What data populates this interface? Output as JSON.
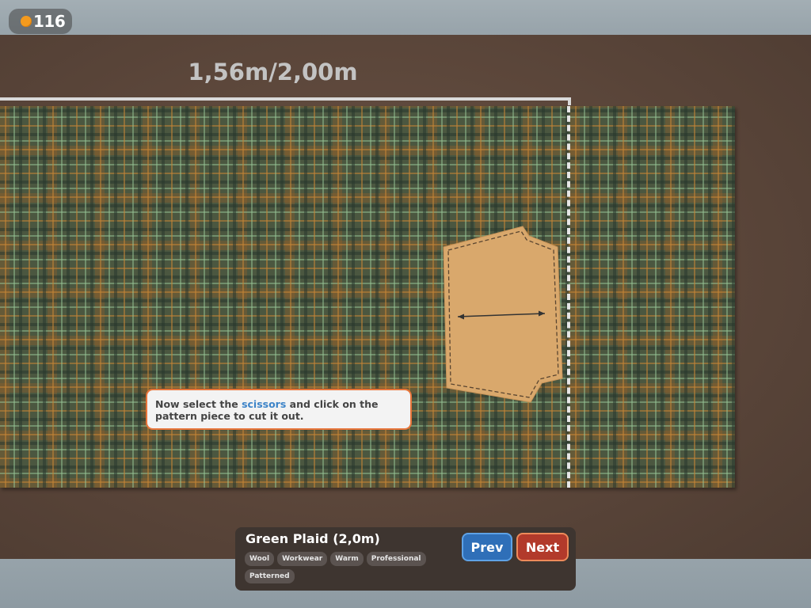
{
  "hud": {
    "coins": "116",
    "coin_icon": "coin-icon"
  },
  "measurement": {
    "label": "1,56m/2,00m"
  },
  "fabric": {
    "pattern": "green-plaid",
    "colors": {
      "base": "#4b5740",
      "orange_stripe": "#c48436",
      "light_stripe": "#96c496"
    }
  },
  "pattern_piece": {
    "color": "#d9a86c",
    "grain_arrow_icon": "double-arrow-icon"
  },
  "tooltip": {
    "text_before": "Now select the ",
    "highlight": "scissors",
    "text_after": " and click on the pattern piece to cut it out."
  },
  "info_panel": {
    "title": "Green Plaid (2,0m)",
    "tags": [
      "Wool",
      "Workwear",
      "Warm",
      "Professional",
      "Patterned"
    ],
    "prev_label": "Prev",
    "next_label": "Next"
  },
  "colors": {
    "accent_orange": "#e8753a",
    "highlight_blue": "#3d84c8",
    "prev_blue": "#2f6fb8",
    "next_red": "#b23a2b"
  }
}
